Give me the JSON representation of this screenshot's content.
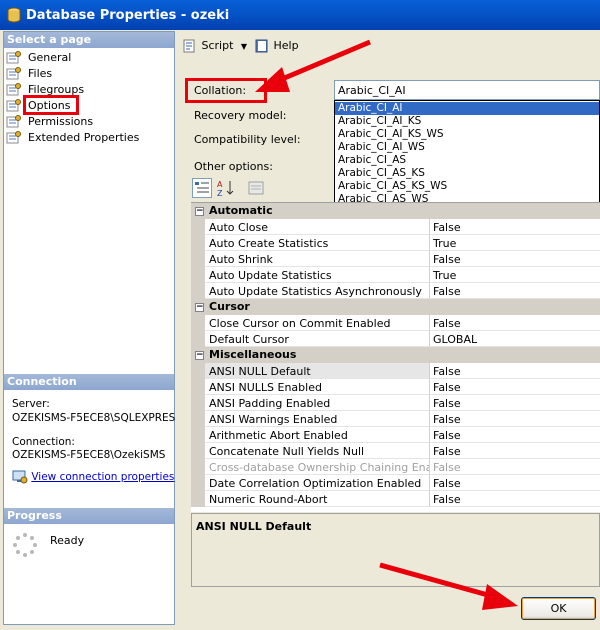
{
  "window": {
    "title": "Database Properties - ozeki"
  },
  "left_pane": {
    "select_page_header": "Select a page",
    "pages": [
      {
        "label": "General",
        "icon": "page-settings-icon"
      },
      {
        "label": "Files",
        "icon": "page-settings-icon"
      },
      {
        "label": "Filegroups",
        "icon": "page-settings-icon"
      },
      {
        "label": "Options",
        "icon": "page-settings-icon"
      },
      {
        "label": "Permissions",
        "icon": "page-settings-icon"
      },
      {
        "label": "Extended Properties",
        "icon": "page-settings-icon"
      }
    ],
    "connection_header": "Connection",
    "server_label": "Server:",
    "server_value": "OZEKISMS-F5ECE8\\SQLEXPRES",
    "connection_label": "Connection:",
    "connection_value": "OZEKISMS-F5ECE8\\OzekiSMS",
    "view_connection_link": "View connection properties",
    "progress_header": "Progress",
    "progress_status": "Ready"
  },
  "toolbar": {
    "script_label": "Script",
    "help_label": "Help"
  },
  "form": {
    "collation_label": "Collation:",
    "collation_value": "Arabic_CI_AI",
    "recovery_label": "Recovery model:",
    "compat_label": "Compatibility level:",
    "other_options_label": "Other options:"
  },
  "collation_options": [
    "Arabic_CI_AI",
    "Arabic_CI_AI_KS",
    "Arabic_CI_AI_KS_WS",
    "Arabic_CI_AI_WS",
    "Arabic_CI_AS",
    "Arabic_CI_AS_KS",
    "Arabic_CI_AS_KS_WS",
    "Arabic_CI_AS_WS"
  ],
  "property_grid": {
    "categories": [
      {
        "name": "Automatic",
        "rows": [
          {
            "name": "Auto Close",
            "value": "False"
          },
          {
            "name": "Auto Create Statistics",
            "value": "True"
          },
          {
            "name": "Auto Shrink",
            "value": "False"
          },
          {
            "name": "Auto Update Statistics",
            "value": "True"
          },
          {
            "name": "Auto Update Statistics Asynchronously",
            "value": "False"
          }
        ]
      },
      {
        "name": "Cursor",
        "rows": [
          {
            "name": "Close Cursor on Commit Enabled",
            "value": "False"
          },
          {
            "name": "Default Cursor",
            "value": "GLOBAL"
          }
        ]
      },
      {
        "name": "Miscellaneous",
        "rows": [
          {
            "name": "ANSI NULL Default",
            "value": "False"
          },
          {
            "name": "ANSI NULLS Enabled",
            "value": "False"
          },
          {
            "name": "ANSI Padding Enabled",
            "value": "False"
          },
          {
            "name": "ANSI Warnings Enabled",
            "value": "False"
          },
          {
            "name": "Arithmetic Abort Enabled",
            "value": "False"
          },
          {
            "name": "Concatenate Null Yields Null",
            "value": "False"
          },
          {
            "name": "Cross-database Ownership Chaining Enabled",
            "value": "False"
          },
          {
            "name": "Date Correlation Optimization Enabled",
            "value": "False"
          },
          {
            "name": "Numeric Round-Abort",
            "value": "False"
          }
        ]
      }
    ],
    "description_title": "ANSI NULL Default"
  },
  "buttons": {
    "ok_label": "OK"
  },
  "colors": {
    "annotation_red": "#e8000b",
    "title_blue": "#0453c7",
    "selection_blue": "#316ac5"
  }
}
